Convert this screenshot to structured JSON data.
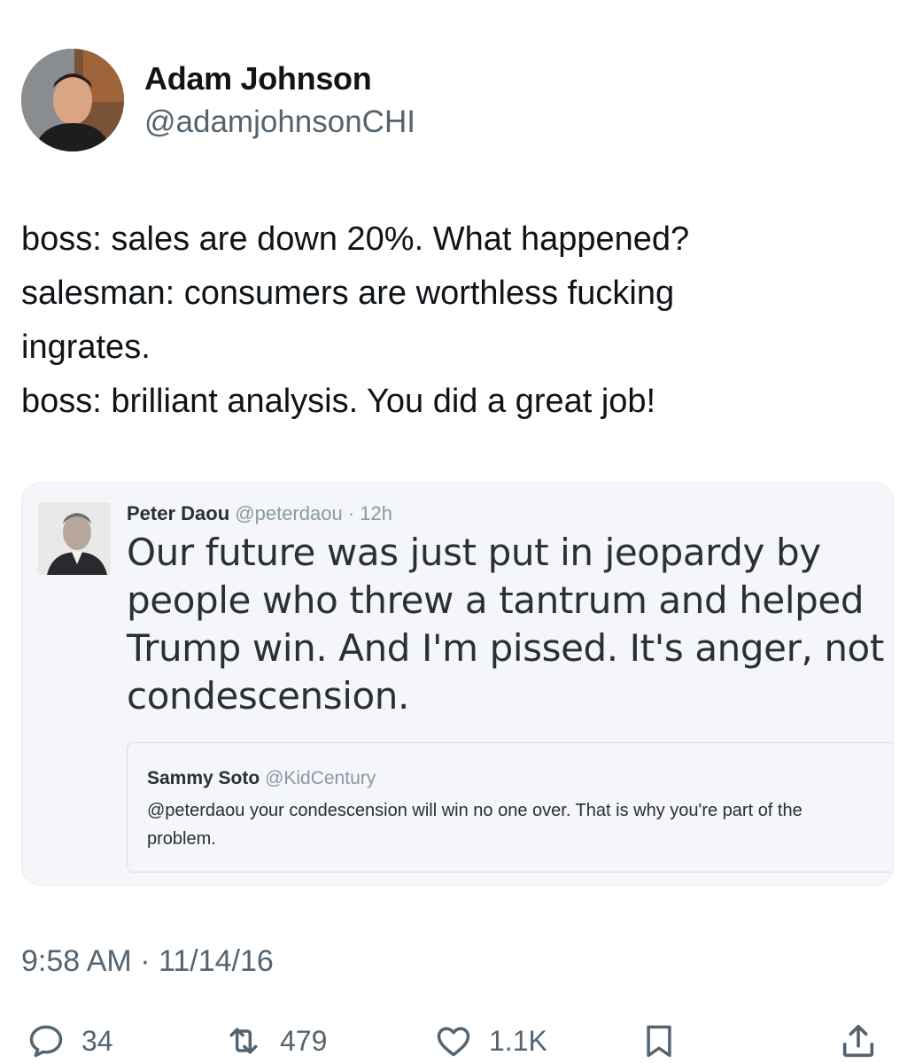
{
  "author": {
    "name": "Adam Johnson",
    "handle": "@adamjohnsonCHI"
  },
  "tweet": {
    "lines": [
      "boss: sales are down 20%. What happened?",
      "salesman: consumers are worthless fucking",
      "ingrates.",
      "boss: brilliant analysis. You did a great job!"
    ]
  },
  "quoted_tweet": {
    "name": "Peter Daou",
    "handle": "@peterdaou",
    "time": "· 12h",
    "lines": [
      "Our future was just put in jeopardy by",
      "people who threw a tantrum and helped",
      "Trump win. And I'm pissed. It's anger, not",
      "condescension."
    ],
    "inner_quote": {
      "name": "Sammy Soto",
      "handle": "@KidCentury",
      "text": "@peterdaou your condescension will win no one over. That is why you're part of the problem."
    }
  },
  "timestamp": "9:58 AM · 11/14/16",
  "actions": {
    "replies": "34",
    "retweets": "479",
    "likes": "1.1K",
    "reply_icon": "reply-icon",
    "retweet_icon": "retweet-icon",
    "like_icon": "heart-icon",
    "bookmark_icon": "bookmark-icon",
    "share_icon": "share-icon"
  },
  "colors": {
    "text": "#0f1419",
    "secondary": "#536471",
    "quote_bg": "#f4f6f9"
  }
}
